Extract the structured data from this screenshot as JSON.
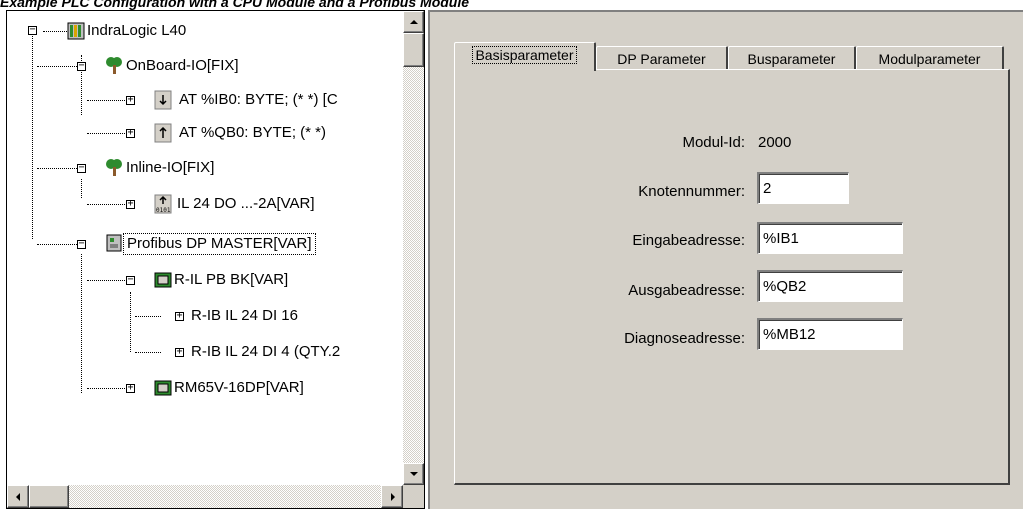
{
  "caption": "Example PLC Configuration with a CPU Module and a Profibus Module",
  "tree": {
    "nodes": [
      {
        "label": "IndraLogic L40",
        "expander": "−",
        "icon": "plc-module-icon"
      },
      {
        "label": "OnBoard-IO[FIX]",
        "expander": "−",
        "icon": "io-tree-icon"
      },
      {
        "label": "AT %IB0: BYTE; (* *) [C",
        "expander": "+",
        "icon": "input-arrow-icon"
      },
      {
        "label": "AT %QB0: BYTE; (* *)",
        "expander": "+",
        "icon": "output-arrow-icon"
      },
      {
        "label": "Inline-IO[FIX]",
        "expander": "−",
        "icon": "io-tree-icon"
      },
      {
        "label": "IL 24 DO ...-2A[VAR]",
        "expander": "+",
        "icon": "digital-output-icon"
      },
      {
        "label": "Profibus DP MASTER[VAR]",
        "expander": "−",
        "icon": "profibus-master-icon"
      },
      {
        "label": "R-IL PB BK[VAR]",
        "expander": "−",
        "icon": "bus-coupler-icon"
      },
      {
        "label": "R-IB IL 24 DI 16",
        "expander": "+",
        "icon": ""
      },
      {
        "label": "R-IB IL 24 DI 4 (QTY.2",
        "expander": "+",
        "icon": ""
      },
      {
        "label": "RM65V-16DP[VAR]",
        "expander": "+",
        "icon": "bus-coupler-icon"
      }
    ]
  },
  "tabs": [
    {
      "label": "Basisparameter",
      "active": true
    },
    {
      "label": "DP Parameter",
      "active": false
    },
    {
      "label": "Busparameter",
      "active": false
    },
    {
      "label": "Modulparameter",
      "active": false
    }
  ],
  "form": {
    "modul_id_label": "Modul-Id:",
    "modul_id_value": "2000",
    "knotennummer_label": "Knotennummer:",
    "knotennummer_value": "2",
    "eingabe_label": "Eingabeadresse:",
    "eingabe_value": "%IB1",
    "ausgabe_label": "Ausgabeadresse:",
    "ausgabe_value": "%QB2",
    "diagnose_label": "Diagnoseadresse:",
    "diagnose_value": "%MB12"
  },
  "colors": {
    "window_face": "#d4d0c8",
    "tree_green": "#2e8b2e"
  }
}
